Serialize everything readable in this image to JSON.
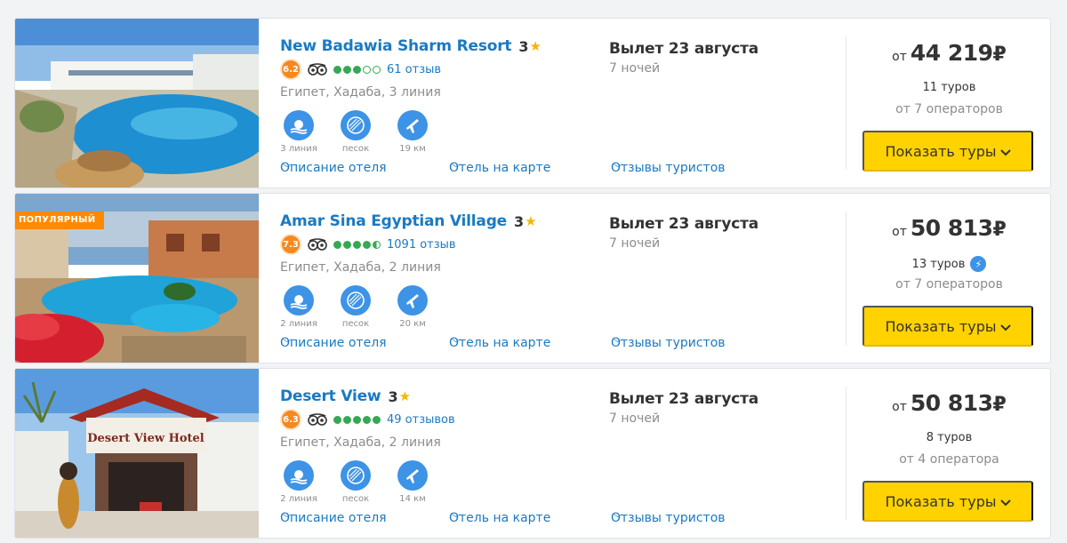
{
  "hotels": [
    {
      "badge": "",
      "name": "New Badawia Sharm Resort",
      "stars": "3",
      "score": "6.2",
      "bubbles": [
        "full",
        "full",
        "full",
        "empty",
        "empty"
      ],
      "reviews": "61 отзыв",
      "location": "Египет, Хадаба, 3 линия",
      "features": [
        {
          "icon": "beach-line-icon",
          "label": "3 линия"
        },
        {
          "icon": "sand-icon",
          "label": "песок"
        },
        {
          "icon": "airport-icon",
          "label": "19 км"
        }
      ],
      "links": {
        "description": "Описание отеля",
        "map": "Отель на карте",
        "reviews": "Отзывы туристов"
      },
      "departure": "Вылет 23 августа",
      "nights": "7 ночей",
      "price_from": "от",
      "price": "44 219",
      "currency": "₽",
      "tours": "11 туров",
      "instant": false,
      "operators": "от 7 операторов",
      "button": "Показать туры"
    },
    {
      "badge": "ПОПУЛЯРНЫЙ",
      "name": "Amar Sina Egyptian Village",
      "stars": "3",
      "score": "7.3",
      "bubbles": [
        "full",
        "full",
        "full",
        "full",
        "half"
      ],
      "reviews": "1091 отзыв",
      "location": "Египет, Хадаба, 2 линия",
      "features": [
        {
          "icon": "beach-line-icon",
          "label": "2 линия"
        },
        {
          "icon": "sand-icon",
          "label": "песок"
        },
        {
          "icon": "airport-icon",
          "label": "20 км"
        }
      ],
      "links": {
        "description": "Описание отеля",
        "map": "Отель на карте",
        "reviews": "Отзывы туристов"
      },
      "departure": "Вылет 23 августа",
      "nights": "7 ночей",
      "price_from": "от",
      "price": "50 813",
      "currency": "₽",
      "tours": "13 туров",
      "instant": true,
      "operators": "от 7 операторов",
      "button": "Показать туры"
    },
    {
      "badge": "",
      "name": "Desert View",
      "stars": "3",
      "score": "6.3",
      "bubbles": [
        "full",
        "full",
        "full",
        "full",
        "full"
      ],
      "reviews": "49 отзывов",
      "location": "Египет, Хадаба, 2 линия",
      "features": [
        {
          "icon": "beach-line-icon",
          "label": "2 линия"
        },
        {
          "icon": "sand-icon",
          "label": "песок"
        },
        {
          "icon": "airport-icon",
          "label": "14 км"
        }
      ],
      "links": {
        "description": "Описание отеля",
        "map": "Отель на карте",
        "reviews": "Отзывы туристов"
      },
      "departure": "Вылет 23 августа",
      "nights": "7 ночей",
      "price_from": "от",
      "price": "50 813",
      "currency": "₽",
      "tours": "8 туров",
      "instant": false,
      "operators": "от 4 оператора",
      "button": "Показать туры",
      "photo_sign": "Desert View Hotel"
    }
  ],
  "colors": {
    "link": "#1a7ac2",
    "button": "#ffd200",
    "score": "#f7881f",
    "badge": "#ff8a00",
    "feature": "#3d93e6"
  }
}
